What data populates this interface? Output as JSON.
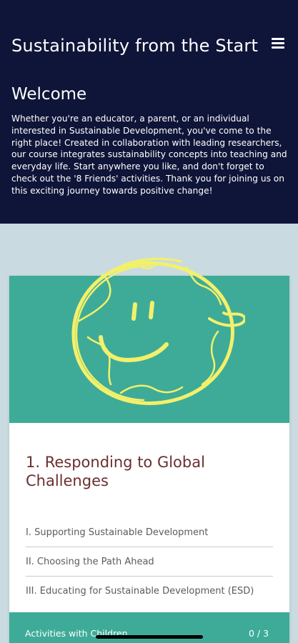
{
  "header": {
    "title": "Sustainability from the Start",
    "menu_icon": "hamburger-menu-icon"
  },
  "welcome": {
    "title": "Welcome",
    "body": "Whether you're an educator, a parent, or an individual interested in Sustainable Development, you've come to the right place! Created in collaboration with leading researchers, our course integrates sustainability concepts into teaching and everyday life. Start anywhere you like, and don't forget to check out the '8 Friends' activities. Thank you for joining us on this exciting journey towards positive change!"
  },
  "module": {
    "image_icon": "smiling-globe-icon",
    "title": "1. Responding to Global Challenges",
    "lessons": [
      "I. Supporting Sustainable Development",
      "II. Choosing the Path Ahead",
      "III. Educating for Sustainable Development (ESD)"
    ],
    "footer_label": "Activities with Children",
    "footer_count": "0 / 3"
  },
  "colors": {
    "header_bg": "#0f1538",
    "page_bg": "#c9dbe0",
    "accent_teal": "#3eab98",
    "globe_yellow": "#f3f06a",
    "title_maroon": "#6b2f2f"
  }
}
